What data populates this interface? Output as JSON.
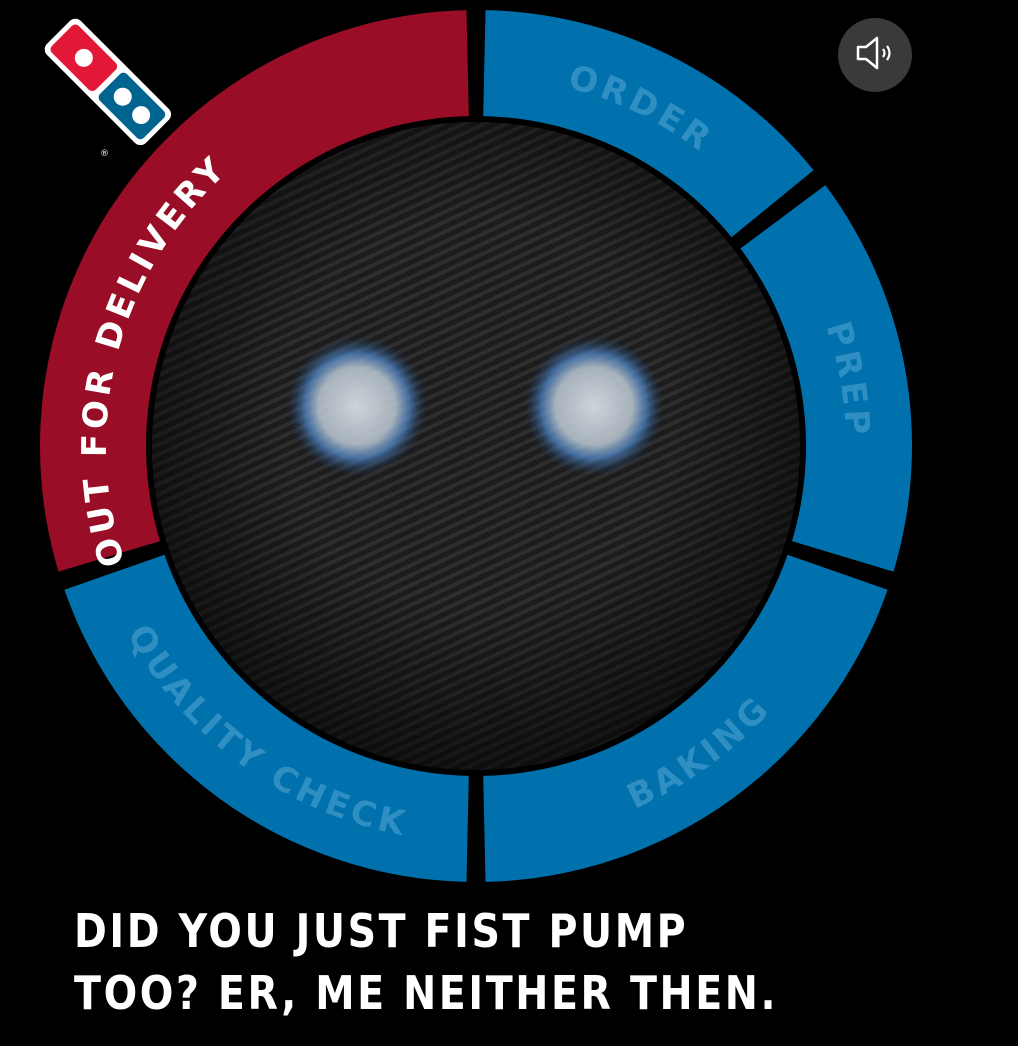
{
  "tracker": {
    "stages": [
      {
        "label": "ORDER",
        "status": "complete"
      },
      {
        "label": "PREP",
        "status": "complete"
      },
      {
        "label": "BAKING",
        "status": "complete"
      },
      {
        "label": "QUALITY CHECK",
        "status": "complete"
      },
      {
        "label": "OUT FOR DELIVERY",
        "status": "active"
      }
    ]
  },
  "colors": {
    "background": "#000000",
    "active_stage": "#990d27",
    "inactive_stage": "#0071ac",
    "inactive_label": "#2f8fc2",
    "active_label": "#ffffff",
    "logo_red": "#e31837",
    "logo_blue": "#006491"
  },
  "icons": {
    "brand": "dominos-domino-logo-icon",
    "sound": "speaker-icon"
  },
  "message": {
    "text": "DID YOU JUST FIST PUMP TOO? ER, ME NEITHER THEN."
  }
}
